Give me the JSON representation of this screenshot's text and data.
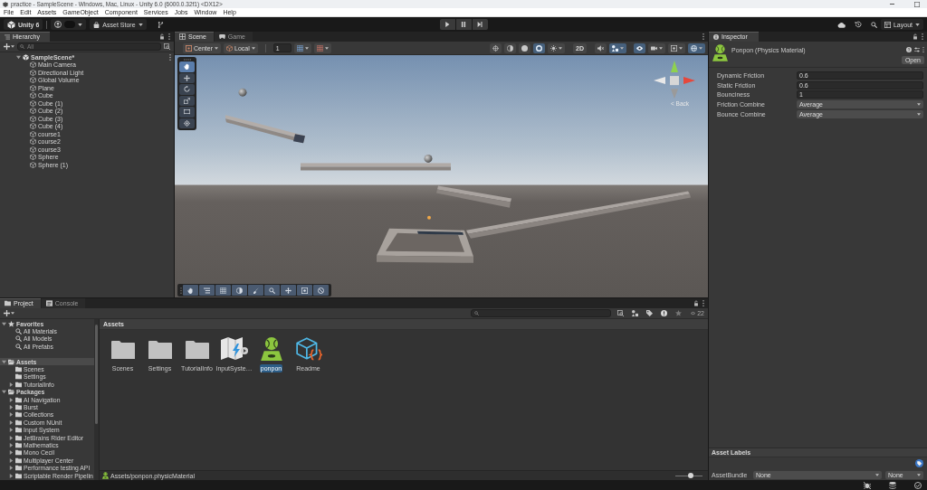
{
  "window": {
    "title": "practice - SampleScene - Windows, Mac, Linux - Unity 6.0 (6000.0.32f1) <DX12>"
  },
  "menu_bar": [
    "File",
    "Edit",
    "Assets",
    "GameObject",
    "Component",
    "Services",
    "Jobs",
    "Window",
    "Help"
  ],
  "toolbar": {
    "editor_button": "Unity 6",
    "asset_store": "Asset Store",
    "layout": "Layout"
  },
  "hierarchy": {
    "tab": {
      "label": "Hierarchy",
      "selected": true
    },
    "search": {
      "placeholder": "All"
    },
    "tree": [
      {
        "label": "SampleScene*",
        "expanded": true,
        "children": [
          {
            "label": "Main Camera"
          },
          {
            "label": "Directional Light"
          },
          {
            "label": "Global Volume"
          },
          {
            "label": "Plane"
          },
          {
            "label": "Cube"
          },
          {
            "label": "Cube (1)"
          },
          {
            "label": "Cube (2)"
          },
          {
            "label": "Cube (3)"
          },
          {
            "label": "Cube (4)"
          },
          {
            "label": "course1"
          },
          {
            "label": "course2"
          },
          {
            "label": "course3"
          },
          {
            "label": "Sphere"
          },
          {
            "label": "Sphere (1)"
          }
        ]
      }
    ]
  },
  "scene": {
    "tabs": [
      {
        "label": "Scene",
        "selected": true
      },
      {
        "label": "Game",
        "selected": false
      }
    ],
    "pivot": "Center",
    "space": "Local",
    "snap_value": "1",
    "view_options": [
      {
        "kind": "crosshair",
        "selected": false
      },
      {
        "kind": "half-sphere",
        "selected": false
      },
      {
        "kind": "sphere",
        "selected": false
      },
      {
        "kind": "ring",
        "selected": true
      },
      {
        "kind": "sun",
        "selected": false
      },
      {
        "kind": "dimension",
        "label": "2D",
        "selected": false
      },
      {
        "kind": "speaker",
        "selected": false
      },
      {
        "kind": "shapes",
        "selected": true
      },
      {
        "kind": "eye",
        "selected": true
      },
      {
        "kind": "camera",
        "selected": false
      },
      {
        "kind": "box",
        "selected": false
      },
      {
        "kind": "globe",
        "selected": true
      }
    ],
    "tools": [
      {
        "kind": "hand",
        "selected": true
      },
      {
        "kind": "move",
        "selected": false
      },
      {
        "kind": "rotate",
        "selected": false
      },
      {
        "kind": "scale",
        "selected": false
      },
      {
        "kind": "rect",
        "selected": false
      },
      {
        "kind": "transform",
        "selected": false
      }
    ],
    "orientation_label": "< Back"
  },
  "inspector": {
    "tab": {
      "label": "Inspector",
      "selected": true
    },
    "title": "Ponpon (Physics Material)",
    "open_button": "Open",
    "properties": [
      {
        "label": "Dynamic Friction",
        "value": "0.6",
        "kind": "number"
      },
      {
        "label": "Static Friction",
        "value": "0.6",
        "kind": "number"
      },
      {
        "label": "Bounciness",
        "value": "1",
        "kind": "number"
      },
      {
        "label": "Friction Combine",
        "value": "Average",
        "kind": "dropdown"
      },
      {
        "label": "Bounce Combine",
        "value": "Average",
        "kind": "dropdown"
      }
    ],
    "asset_labels": "Asset Labels",
    "asset_bundle": {
      "label": "AssetBundle",
      "name": "None",
      "variant": "None"
    }
  },
  "project": {
    "tabs": [
      {
        "label": "Project",
        "selected": true
      },
      {
        "label": "Console",
        "selected": false
      }
    ],
    "visible_count": "22",
    "tree": [
      {
        "label": "Favorites",
        "kind": "favorites",
        "expanded": true,
        "selected": false,
        "children": [
          {
            "label": "All Materials",
            "kind": "search",
            "selected": false
          },
          {
            "label": "All Models",
            "kind": "search",
            "selected": false
          },
          {
            "label": "All Prefabs",
            "kind": "search",
            "selected": false
          }
        ]
      },
      {
        "label": "Assets",
        "kind": "folder",
        "expanded": true,
        "selected": true,
        "children": [
          {
            "label": "Scenes",
            "kind": "folder",
            "selected": false
          },
          {
            "label": "Settings",
            "kind": "folder",
            "selected": false
          },
          {
            "label": "TutorialInfo",
            "kind": "folder",
            "expanded": false,
            "selected": false
          }
        ]
      },
      {
        "label": "Packages",
        "kind": "folder",
        "expanded": true,
        "selected": false,
        "children": [
          {
            "label": "AI Navigation",
            "kind": "folder",
            "expanded": false,
            "selected": false
          },
          {
            "label": "Burst",
            "kind": "folder",
            "expanded": false,
            "selected": false
          },
          {
            "label": "Collections",
            "kind": "folder",
            "expanded": false,
            "selected": false
          },
          {
            "label": "Custom NUnit",
            "kind": "folder",
            "expanded": false,
            "selected": false
          },
          {
            "label": "Input System",
            "kind": "folder",
            "expanded": false,
            "selected": false
          },
          {
            "label": "JetBrains Rider Editor",
            "kind": "folder",
            "expanded": false,
            "selected": false
          },
          {
            "label": "Mathematics",
            "kind": "folder",
            "expanded": false,
            "selected": false
          },
          {
            "label": "Mono Cecil",
            "kind": "folder",
            "expanded": false,
            "selected": false
          },
          {
            "label": "Multiplayer Center",
            "kind": "folder",
            "expanded": false,
            "selected": false
          },
          {
            "label": "Performance testing API",
            "kind": "folder",
            "expanded": false,
            "selected": false
          },
          {
            "label": "Scriptable Render Pipelin",
            "kind": "folder",
            "expanded": false,
            "selected": false
          }
        ]
      }
    ],
    "breadcrumb": "Assets",
    "assets": [
      {
        "label": "Scenes",
        "kind": "folder",
        "selected": false
      },
      {
        "label": "Settings",
        "kind": "folder",
        "selected": false
      },
      {
        "label": "TutorialInfo",
        "kind": "folder",
        "selected": false
      },
      {
        "label": "InputSyste…",
        "kind": "input-actions",
        "selected": false
      },
      {
        "label": "ponpon",
        "kind": "physics-material",
        "selected": true
      },
      {
        "label": "Readme",
        "kind": "readme",
        "selected": false
      }
    ],
    "path": "Assets/ponpon.physicMaterial",
    "icon_size": {
      "level": 0.55
    }
  }
}
